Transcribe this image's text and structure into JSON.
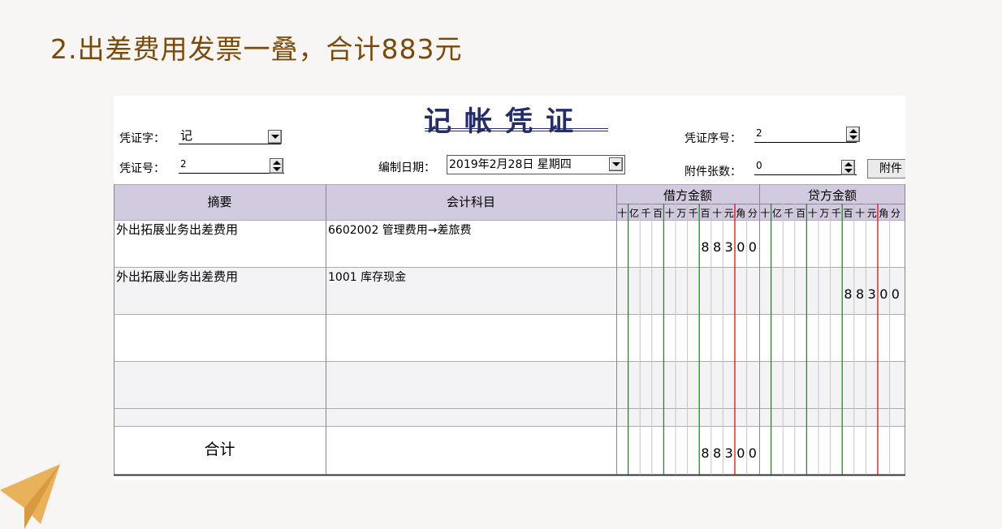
{
  "slide": {
    "title": "2.出差费用发票一叠，合计883元"
  },
  "voucher": {
    "title": "记帐凭证",
    "word_label": "凭证字：",
    "word_value": "记",
    "number_label": "凭证号：",
    "number_value": "2",
    "date_label": "编制日期：",
    "date_value": "2019年2月28日 星期四",
    "seq_label": "凭证序号：",
    "seq_value": "2",
    "attach_label": "附件张数：",
    "attach_value": "0",
    "attach_button": "附件"
  },
  "table": {
    "headers": {
      "summary": "摘要",
      "account": "会计科目",
      "debit": "借方金额",
      "credit": "贷方金额"
    },
    "units": [
      "十",
      "亿",
      "千",
      "百",
      "十",
      "万",
      "千",
      "百",
      "十",
      "元",
      "角",
      "分"
    ],
    "rows": [
      {
        "summary": "外出拓展业务出差费用",
        "account": "6602002 管理费用→差旅费",
        "debit": "88300",
        "credit": ""
      },
      {
        "summary": "外出拓展业务出差费用",
        "account": "1001 库存现金",
        "debit": "",
        "credit": "88300"
      },
      {
        "summary": "",
        "account": "",
        "debit": "",
        "credit": ""
      },
      {
        "summary": "",
        "account": "",
        "debit": "",
        "credit": ""
      }
    ],
    "total": {
      "label": "合计",
      "debit": "88300",
      "credit": ""
    }
  },
  "colors": {
    "title": "#7a4a08",
    "header_bg": "#d2cade",
    "row_alt_bg": "#f3f3f6",
    "green_line": "#0c9a0c",
    "red_line": "#e01010",
    "voucher_title": "#242c6a",
    "plane": "#e9b15a"
  }
}
